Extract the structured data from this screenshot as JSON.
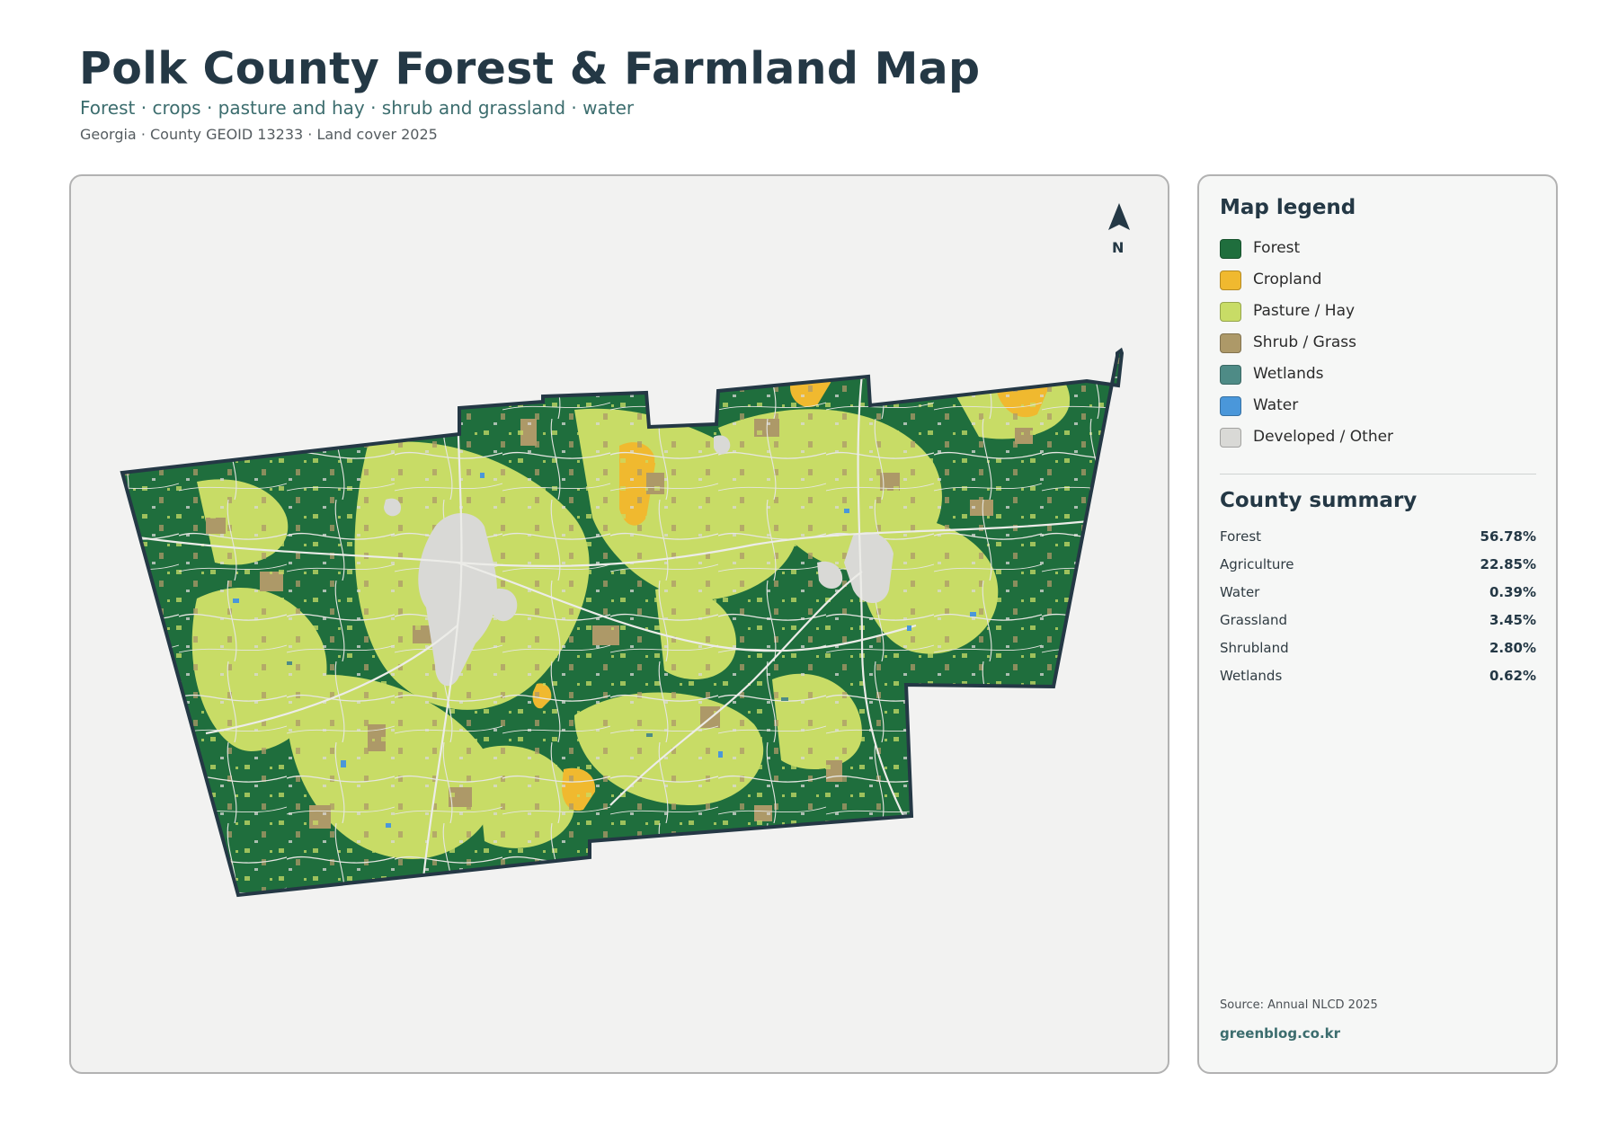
{
  "header": {
    "title": "Polk County Forest & Farmland Map",
    "subtitle": "Forest · crops · pasture and hay · shrub and grassland · water",
    "meta": "Georgia · County GEOID 13233 · Land cover 2025"
  },
  "map": {
    "north_label": "N"
  },
  "legend": {
    "title": "Map legend",
    "items": [
      {
        "label": "Forest",
        "color": "#1f6e3d"
      },
      {
        "label": "Cropland",
        "color": "#f0b92f"
      },
      {
        "label": "Pasture / Hay",
        "color": "#c8dc66"
      },
      {
        "label": "Shrub / Grass",
        "color": "#ad9968"
      },
      {
        "label": "Wetlands",
        "color": "#4e8b86"
      },
      {
        "label": "Water",
        "color": "#4a97da"
      },
      {
        "label": "Developed / Other",
        "color": "#d9d9d6"
      }
    ]
  },
  "summary": {
    "title": "County summary",
    "rows": [
      {
        "label": "Forest",
        "value": "56.78%"
      },
      {
        "label": "Agriculture",
        "value": "22.85%"
      },
      {
        "label": "Water",
        "value": "0.39%"
      },
      {
        "label": "Grassland",
        "value": "3.45%"
      },
      {
        "label": "Shrubland",
        "value": "2.80%"
      },
      {
        "label": "Wetlands",
        "value": "0.62%"
      }
    ]
  },
  "footer": {
    "source": "Source: Annual NLCD 2025",
    "site": "greenblog.co.kr"
  }
}
